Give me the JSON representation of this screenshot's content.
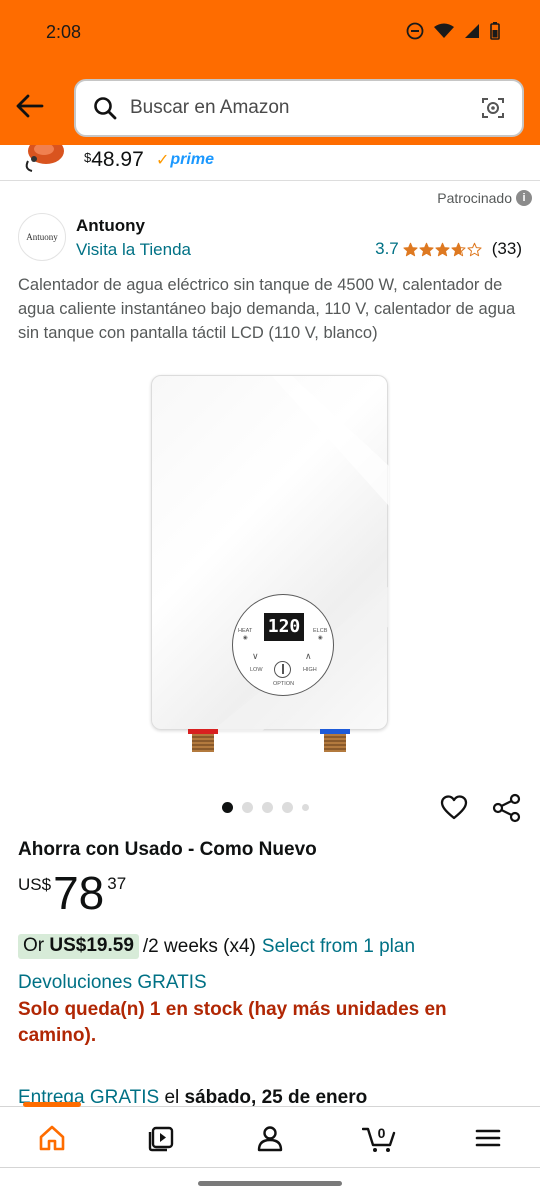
{
  "status_bar": {
    "time": "2:08"
  },
  "header": {
    "search_placeholder": "Buscar en Amazon",
    "icons": [
      "back-arrow-icon",
      "search-icon",
      "camera-lens-icon"
    ],
    "color": "#fe6c00"
  },
  "previous_item": {
    "currency": "$",
    "price": "48.97",
    "prime_label": "prime"
  },
  "sponsored": {
    "label": "Patrocinado",
    "info_glyph": "i"
  },
  "brand": {
    "logo_text": "Antuony",
    "name": "Antuony",
    "store_link": "Visita la Tienda"
  },
  "rating": {
    "value": "3.7",
    "stars": 3.7,
    "count": "(33)"
  },
  "product": {
    "title": "Calentador de agua eléctrico sin tanque de 4500 W, calentador de agua caliente instantáneo bajo demanda, 110 V, calentador de agua sin tanque con pantalla táctil LCD (110 V, blanco)",
    "display_value": "120",
    "panel_labels": {
      "heat": "HEAT",
      "elcb": "ELCB",
      "low": "LOW",
      "high": "HIGH",
      "option": "OPTION"
    }
  },
  "carousel": {
    "total_dots": 5,
    "active_index": 0
  },
  "offer": {
    "heading": "Ahorra con Usado - Como Nuevo",
    "currency": "US$",
    "price_whole": "78",
    "price_fraction": "37",
    "installment_or": "Or",
    "installment_amount": "US$19.59",
    "installment_terms": "/2 weeks (x4)",
    "installment_link": "Select from 1 plan",
    "returns": "Devoluciones GRATIS",
    "stock": "Solo queda(n) 1 en stock (hay más unidades en camino).",
    "delivery_link": "Entrega GRATIS",
    "delivery_connector": "el",
    "delivery_date": "sábado, 25 de enero"
  },
  "bottom_nav": {
    "items": [
      "home-icon",
      "video-icon",
      "account-icon",
      "cart-icon",
      "menu-icon"
    ],
    "cart_count": "0",
    "active": "home-icon"
  },
  "colors": {
    "accent": "#fe6c00",
    "link": "#007185",
    "stock_red": "#b12704",
    "prime_blue": "#1a98ff",
    "installment_bg": "#d7ebd8"
  }
}
